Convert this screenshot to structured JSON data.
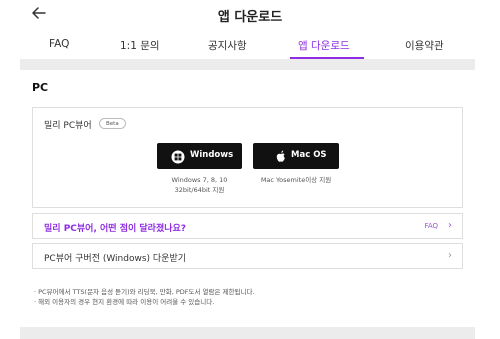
{
  "header": {
    "back_icon": "arrow-left-icon",
    "title": "앱 다운로드"
  },
  "tabs": [
    {
      "label": "FAQ",
      "active": false
    },
    {
      "label": "1:1 문의",
      "active": false
    },
    {
      "label": "공지사항",
      "active": false
    },
    {
      "label": "앱 다운로드",
      "active": true
    },
    {
      "label": "이용약관",
      "active": false
    }
  ],
  "section": {
    "title": "PC"
  },
  "viewer": {
    "title": "밀리 PC뷰어",
    "badge": "Beta",
    "windows": {
      "icon": "windows-icon",
      "label": "Windows",
      "req_line1": "Windows 7, 8, 10",
      "req_line2": "32bit/64bit 지원"
    },
    "mac": {
      "icon": "apple-icon",
      "label": "Mac OS",
      "req_line1": "Mac Yosemite이상 지원"
    }
  },
  "links": {
    "faq_text": "밀리 PC뷰어, 어떤 점이 달라졌나요?",
    "faq_tag": "FAQ",
    "faq_chevron": "›",
    "old_text": "PC뷰어 구버전 (Windows) 다운받기",
    "old_chevron": "›"
  },
  "notes": [
    "· PC뷰어에서 TTS(문자 음성 듣기)와 리딩북, 만화, PDF도서 열람은 제한됩니다.",
    "· 해외 이용자의 경우 현지 환경에 따라 이용이 어려울 수 있습니다."
  ],
  "colors": {
    "accent": "#8e2de2",
    "button_bg": "#111111",
    "band": "#ececec"
  }
}
